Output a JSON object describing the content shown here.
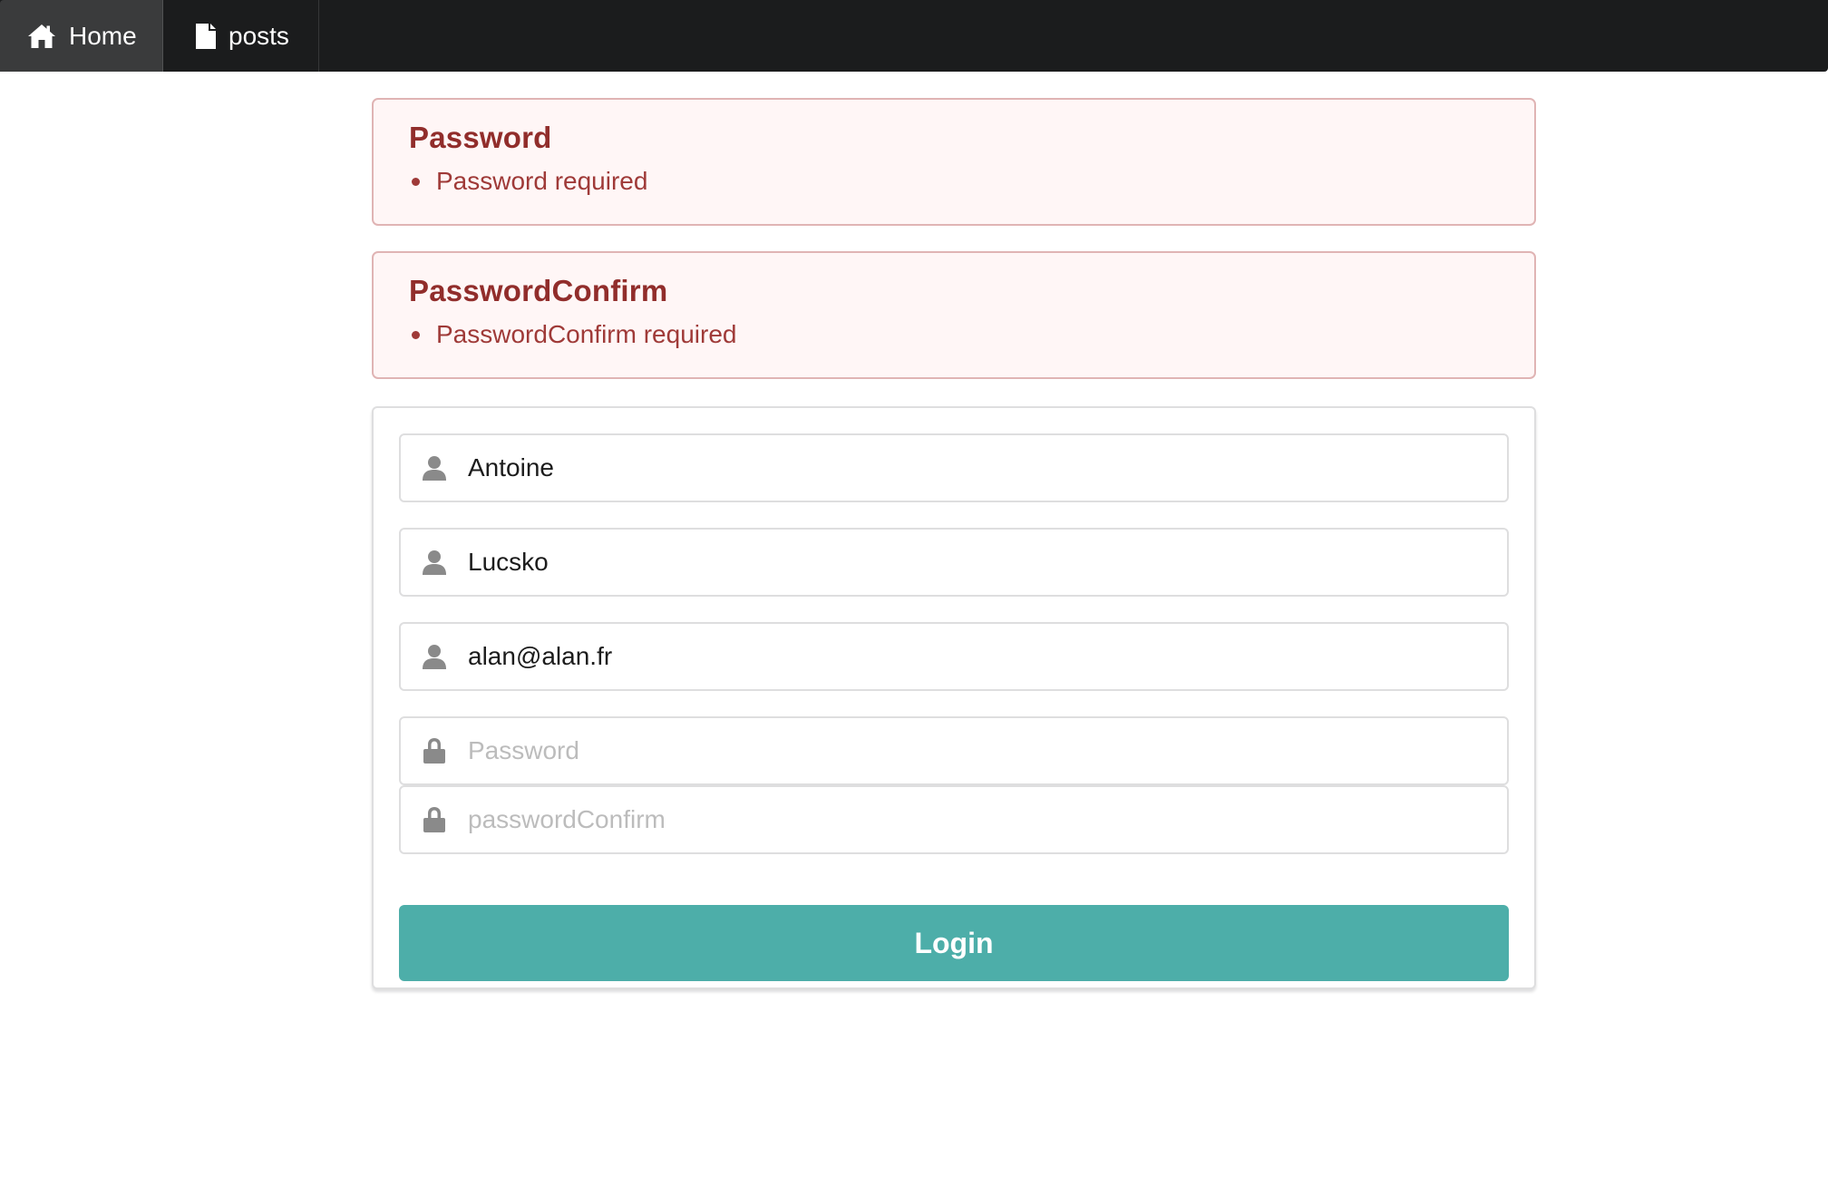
{
  "nav": {
    "items": [
      {
        "label": "Home",
        "icon": "home-icon",
        "active": true
      },
      {
        "label": "posts",
        "icon": "file-icon",
        "active": false
      }
    ]
  },
  "errors": [
    {
      "title": "Password",
      "messages": [
        "Password required"
      ]
    },
    {
      "title": "PasswordConfirm",
      "messages": [
        "PasswordConfirm required"
      ]
    }
  ],
  "form": {
    "firstname": {
      "value": "Antoine",
      "icon": "user-icon"
    },
    "lastname": {
      "value": "Lucsko",
      "icon": "user-icon"
    },
    "email": {
      "value": "alan@alan.fr",
      "icon": "user-icon"
    },
    "password": {
      "value": "",
      "placeholder": "Password",
      "icon": "lock-icon"
    },
    "password_confirm": {
      "value": "",
      "placeholder": "passwordConfirm",
      "icon": "lock-icon"
    },
    "submit_label": "Login"
  },
  "colors": {
    "nav_bg": "#1b1c1d",
    "nav_active_bg": "#3a3b3c",
    "error_bg": "#fff6f6",
    "error_border": "#e0b4b4",
    "error_text": "#9f3a38",
    "button_bg": "#4daea9"
  }
}
